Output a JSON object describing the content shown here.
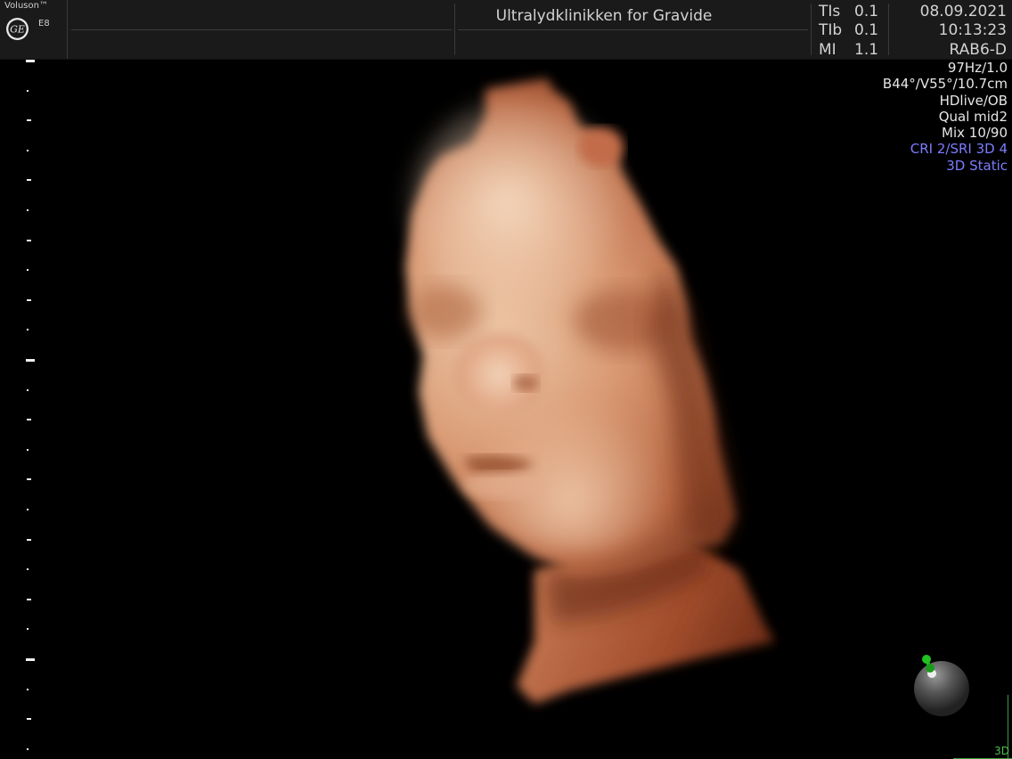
{
  "header": {
    "brand": "Voluson™",
    "model": "E8",
    "clinic": "Ultralydklinikken for Gravide",
    "tis_label": "TIs",
    "tis_value": "0.1",
    "tib_label": "TIb",
    "tib_value": "0.1",
    "mi_label": "MI",
    "mi_value": "1.1",
    "date": "08.09.2021",
    "time": "10:13:23",
    "probe": "RAB6-D"
  },
  "params": [
    {
      "text": "97Hz/1.0",
      "highlight": false
    },
    {
      "text": "B44°/V55°/10.7cm",
      "highlight": false
    },
    {
      "text": "HDlive/OB",
      "highlight": false
    },
    {
      "text": "Qual mid2",
      "highlight": false
    },
    {
      "text": "Mix 10/90",
      "highlight": false
    },
    {
      "text": "CRI 2/SRI 3D 4",
      "highlight": true
    },
    {
      "text": "3D Static",
      "highlight": true
    }
  ],
  "colors": {
    "highlight": "#7c7cff",
    "mode_indicator": "#4fbf4f",
    "orientation_marker": "#22c022",
    "skin_light": "#e9c0a0",
    "skin_mid": "#c9805a",
    "skin_dark": "#7a3a20"
  },
  "render": {
    "subject": "fetal-face-3d-render"
  },
  "mode_indicator": "3D"
}
